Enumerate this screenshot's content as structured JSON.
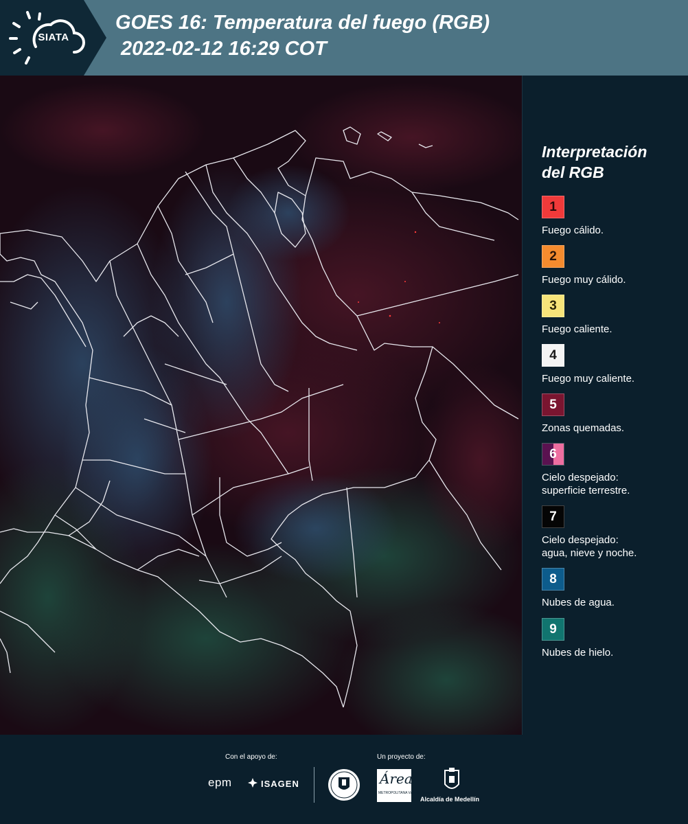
{
  "header": {
    "logo_text": "SIATA",
    "title": "GOES 16: Temperatura del fuego (RGB)\n 2022-02-12 16:29 COT"
  },
  "legend": {
    "title": "Interpretación\ndel RGB",
    "items": [
      {
        "number": "1",
        "label": "Fuego cálido.",
        "colors": [
          "#f03a3a"
        ],
        "text_color": "#2b0a0a"
      },
      {
        "number": "2",
        "label": "Fuego muy cálido.",
        "colors": [
          "#f58b2e"
        ],
        "text_color": "#2b1408"
      },
      {
        "number": "3",
        "label": "Fuego caliente.",
        "colors": [
          "#f7e47a"
        ],
        "text_color": "#2b2508"
      },
      {
        "number": "4",
        "label": "Fuego muy caliente.",
        "colors": [
          "#f4f4f4"
        ],
        "text_color": "#1a1a1a"
      },
      {
        "number": "5",
        "label": "Zonas quemadas.",
        "colors": [
          "#7a1530"
        ],
        "text_color": "#ffffff"
      },
      {
        "number": "6",
        "label": "Cielo despejado:\nsuperficie terrestre.",
        "colors": [
          "#5a1250",
          "#ee6ea0"
        ],
        "text_color": "#ffffff"
      },
      {
        "number": "7",
        "label": "Cielo despejado:\nagua, nieve y noche.",
        "colors": [
          "#050505"
        ],
        "text_color": "#ffffff"
      },
      {
        "number": "8",
        "label": "Nubes de agua.",
        "colors": [
          "#0d5c8c"
        ],
        "text_color": "#ffffff"
      },
      {
        "number": "9",
        "label": "Nubes de hielo.",
        "colors": [
          "#11756f"
        ],
        "text_color": "#ffffff"
      }
    ]
  },
  "footer": {
    "support_label": "Con el apoyo de:",
    "project_label": "Un proyecto de:",
    "epm": "epm",
    "isagen": "ISAGEN",
    "area_script": "Área",
    "area_small": "METROPOLITANA\nValle de Aburrá",
    "alcaldia": "Alcaldía de Medellín"
  }
}
